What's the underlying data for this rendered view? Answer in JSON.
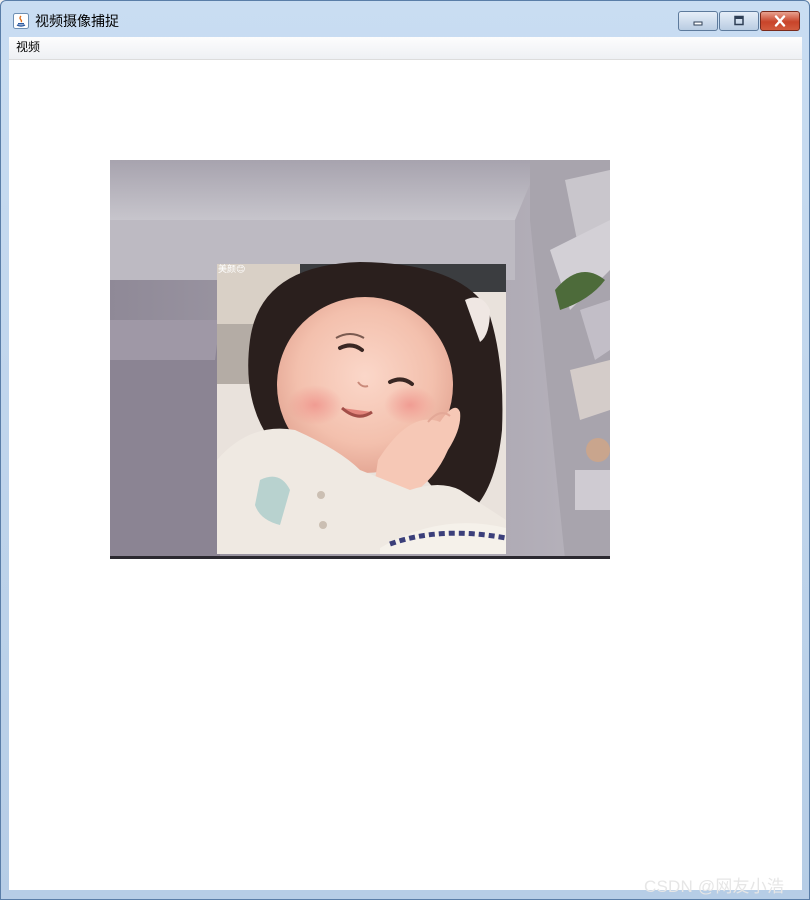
{
  "window": {
    "title": "视频摄像捕捉",
    "controls": [
      "minimize",
      "maximize",
      "close"
    ]
  },
  "menubar": {
    "items": [
      "视频"
    ]
  },
  "video": {
    "overlay_label": "美颜😊"
  },
  "watermark": "CSDN @网友小浩",
  "colors": {
    "title_bar": "#c9ddf2",
    "client_bg": "#ffffff",
    "close_button": "#c8442a"
  }
}
